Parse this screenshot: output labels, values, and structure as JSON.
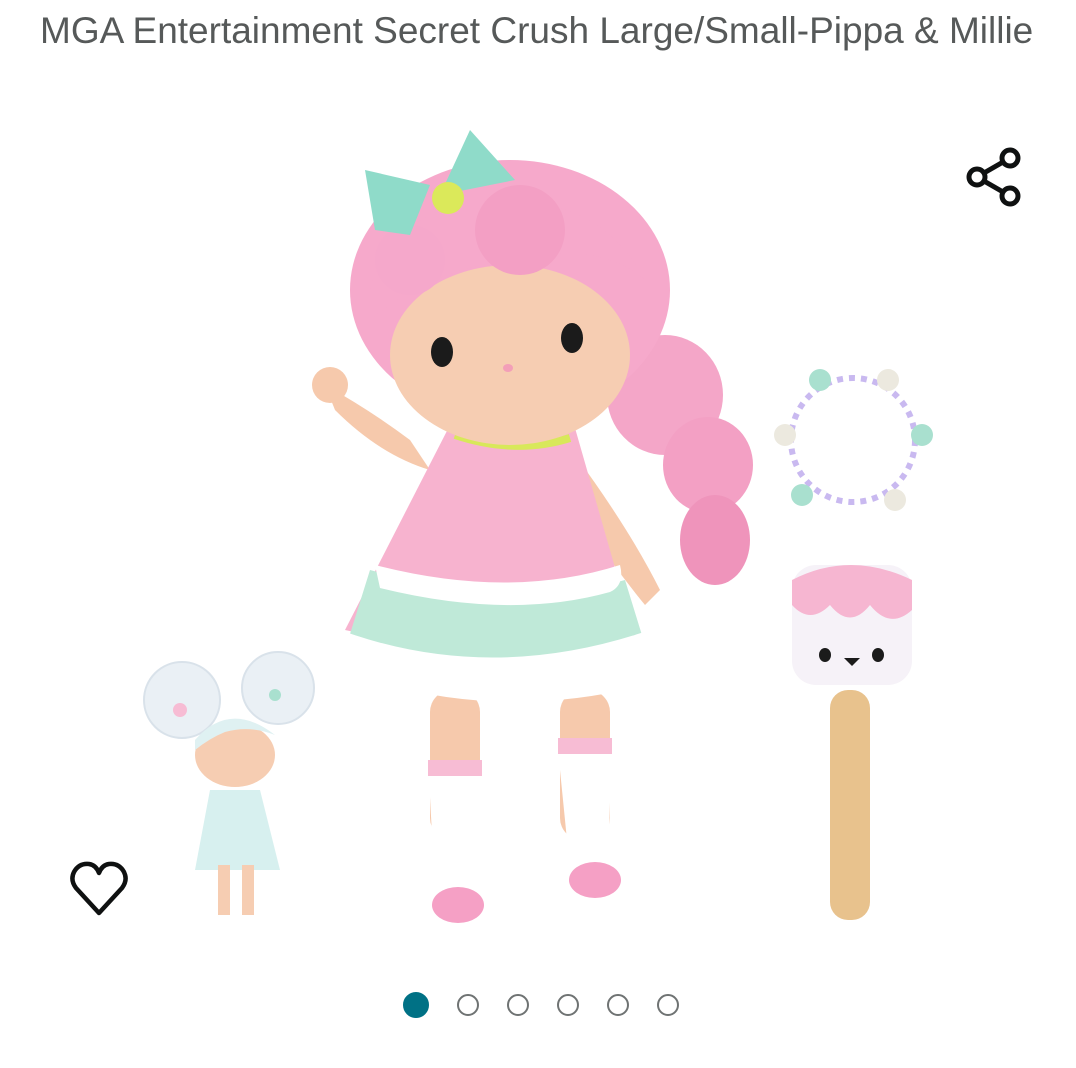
{
  "product": {
    "title": "MGA Entertainment Secret Crush Large/Small-Pippa & Millie"
  },
  "icons": {
    "share": "share-icon",
    "wishlist": "heart-icon"
  },
  "carousel": {
    "total": 6,
    "active_index": 0
  },
  "colors": {
    "active_dot": "#007185",
    "inactive_dot_border": "#6f7373",
    "title_text": "#565959"
  }
}
